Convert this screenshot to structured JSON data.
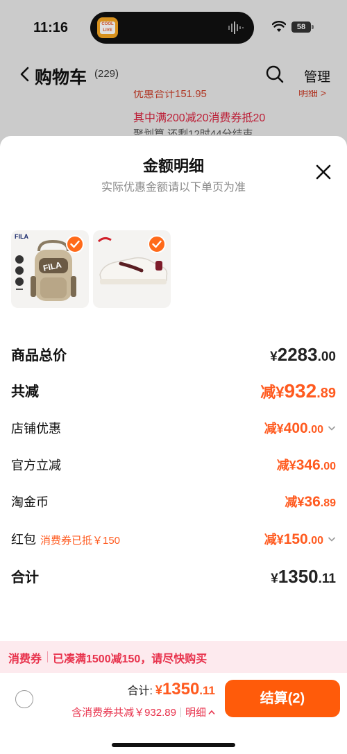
{
  "status_bar": {
    "time": "11:16",
    "island_app_label": "COOL LIVE",
    "battery": "58"
  },
  "header": {
    "title": "购物车",
    "count": "(229)",
    "manage": "管理"
  },
  "background_promo": {
    "line1": "优惠合计151.95",
    "detail": "明细 >",
    "line2": "其中满200减20消费券抵20",
    "line3": "聚划算 还剩12时44分结束"
  },
  "sheet": {
    "title": "金额明细",
    "subtitle": "实际优惠金额请以下单页为准"
  },
  "products": [
    {
      "name": "fila-backpack",
      "brand": "FILA",
      "checked": true
    },
    {
      "name": "anta-sneaker",
      "checked": true
    }
  ],
  "summary": {
    "goods_total": {
      "label": "商品总价",
      "prefix": "¥",
      "int": "2283",
      "dec": ".00"
    },
    "total_discount": {
      "label": "共减",
      "prefix": "减¥",
      "int": "932",
      "dec": ".89"
    },
    "store_discount": {
      "label": "店铺优惠",
      "prefix": "减¥",
      "int": "400",
      "dec": ".00"
    },
    "official_discount": {
      "label": "官方立减",
      "prefix": "减¥",
      "int": "346",
      "dec": ".00"
    },
    "coins": {
      "label": "淘金币",
      "prefix": "减¥",
      "int": "36",
      "dec": ".89"
    },
    "red_packet": {
      "label": "红包",
      "tag": "消费券已抵￥150",
      "prefix": "减¥",
      "int": "150",
      "dec": ".00"
    },
    "total": {
      "label": "合计",
      "prefix": "¥",
      "int": "1350",
      "dec": ".11"
    }
  },
  "banner": {
    "tag": "消费券",
    "text": "已凑满1500减150，请尽快购买"
  },
  "checkout": {
    "total_label": "合计:",
    "total_prefix": "¥",
    "total_int": "1350",
    "total_dec": ".11",
    "discount_text": "含消费券共减￥932.89",
    "detail_link": "明细",
    "button": "结算(2)"
  },
  "colors": {
    "accent": "#ff5b0a",
    "discount_red": "#e8324c",
    "banner_bg": "#fdeaee"
  }
}
